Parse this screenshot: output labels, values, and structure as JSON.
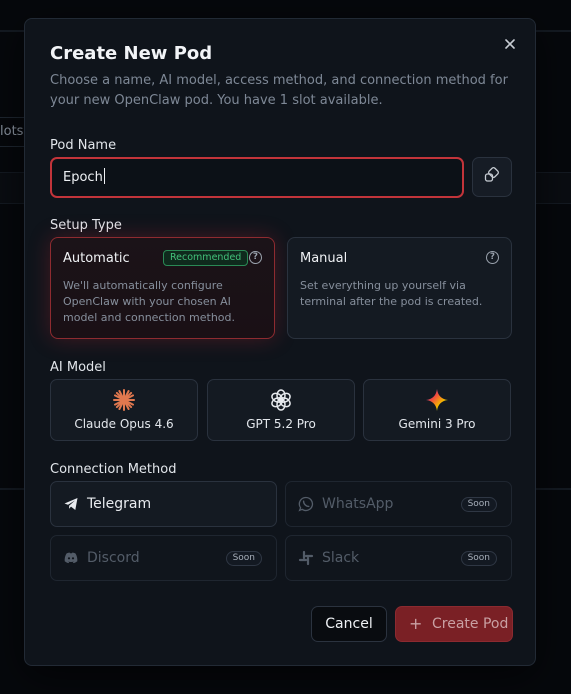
{
  "background": {
    "slots_text": "lots"
  },
  "modal": {
    "title": "Create New Pod",
    "description": "Choose a name, AI model, access method, and connection method for your new OpenClaw pod. You have 1 slot available.",
    "close_icon": "close-icon"
  },
  "pod_name": {
    "label": "Pod Name",
    "value": "Epoch",
    "side_button_icon": "copy-icon"
  },
  "setup_type": {
    "label": "Setup Type",
    "options": [
      {
        "title": "Automatic",
        "badge": "Recommended",
        "description": "We'll automatically configure OpenClaw with your chosen AI model and connection method.",
        "selected": true
      },
      {
        "title": "Manual",
        "description": "Set everything up yourself via terminal after the pod is created.",
        "selected": false
      }
    ],
    "help_glyph": "?"
  },
  "ai_model": {
    "label": "AI Model",
    "options": [
      {
        "name": "Claude Opus 4.6",
        "icon": "claude-icon"
      },
      {
        "name": "GPT 5.2 Pro",
        "icon": "openai-icon"
      },
      {
        "name": "Gemini 3 Pro",
        "icon": "gemini-icon"
      }
    ]
  },
  "connection": {
    "label": "Connection Method",
    "options": [
      {
        "name": "Telegram",
        "icon": "telegram-icon",
        "available": true
      },
      {
        "name": "WhatsApp",
        "icon": "whatsapp-icon",
        "available": false,
        "badge": "Soon"
      },
      {
        "name": "Discord",
        "icon": "discord-icon",
        "available": false,
        "badge": "Soon"
      },
      {
        "name": "Slack",
        "icon": "slack-icon",
        "available": false,
        "badge": "Soon"
      }
    ]
  },
  "actions": {
    "cancel_label": "Cancel",
    "create_label": "Create Pod",
    "create_plus": "+"
  },
  "colors": {
    "accent": "#c2343a",
    "recommended": "#43c17a",
    "modal_bg": "#0f141b"
  }
}
